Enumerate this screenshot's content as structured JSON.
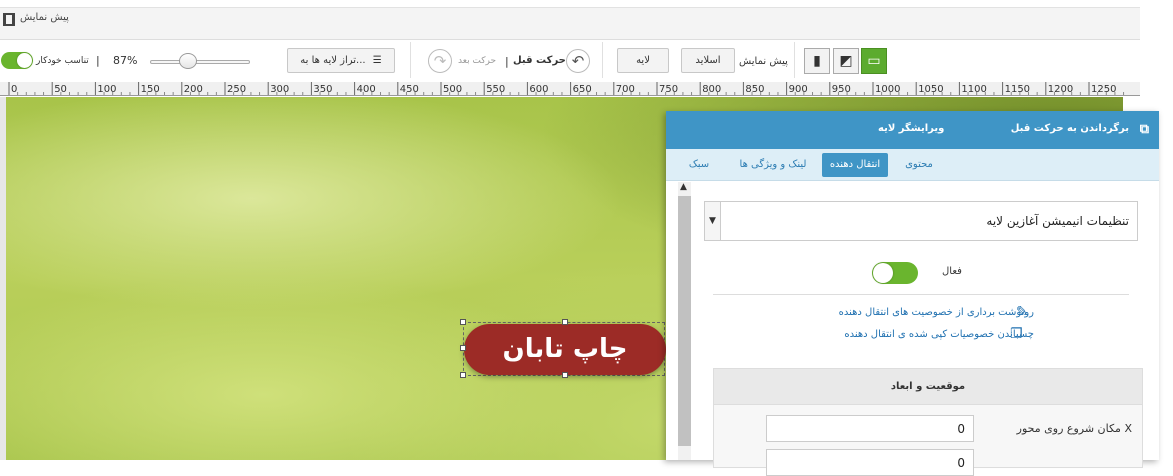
{
  "title_bar": {
    "title": "پیش نمایش",
    "icon": "film-icon"
  },
  "toolbar": {
    "autofit_label": "تناسب خودکار",
    "zoom_value": "87%",
    "zoom_level": 0.36,
    "align_layers_label": "تراز لایه ها به...",
    "undo_label": "حرکت قبل",
    "redo_label": "حرکت بعد",
    "layer_button": "لایه",
    "slide_button": "اسلاید",
    "preview_label": "پیش نمایش",
    "devices": [
      "mobile-icon",
      "tablet-icon",
      "desktop-icon"
    ]
  },
  "ruler": {
    "marks": [
      "0",
      "50",
      "100",
      "150",
      "200",
      "250",
      "300",
      "350",
      "400",
      "450",
      "500",
      "550",
      "600",
      "650",
      "700",
      "750",
      "800",
      "850",
      "900",
      "950",
      "1000",
      "1050",
      "1100",
      "1150",
      "1200",
      "1250"
    ]
  },
  "canvas": {
    "layer_text": "چاپ تابان",
    "layer_color": "#9c2b26"
  },
  "panel": {
    "title": "ویرایشگر لایه",
    "undo_link": "برگرداندن به حرکت قبل",
    "tabs": [
      "محتوی",
      "انتقال دهنده",
      "لینک و ویژگی ها",
      "سبک"
    ],
    "active_tab": "انتقال دهنده",
    "select_value": "تنظیمات انیمیشن آغازین لایه",
    "active_label": "فعال",
    "copy_link": "رونوشت برداری از خصوصیت های انتقال دهنده",
    "paste_link": "چسباندن خصوصیات کپی شده ی انتقال دهنده",
    "position_title": "موقعیت و ابعاد",
    "x_label": "مکان شروع روی محور X",
    "x_value": "0",
    "y_value": "0",
    "accent": "#3f95c6"
  }
}
